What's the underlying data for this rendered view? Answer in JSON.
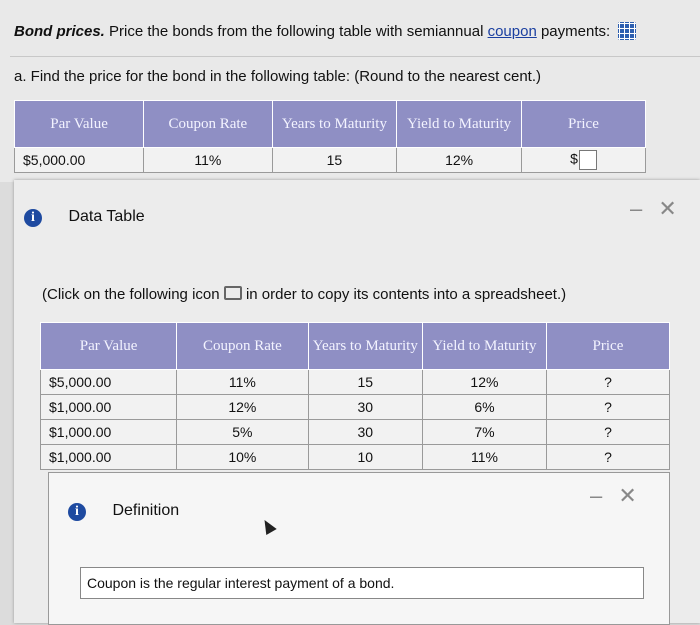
{
  "problem": {
    "title": "Bond prices.",
    "text": "Price the bonds from the following table with semiannual",
    "link": "coupon",
    "text_after": "payments:",
    "grid_icon": "table-grid-icon",
    "part_a": "a. Find the price for the bond in the following table:  (Round to the nearest cent.)"
  },
  "question_table": {
    "headers": [
      "Par Value",
      "Coupon Rate",
      "Years to Maturity",
      "Yield to Maturity",
      "Price"
    ],
    "row": [
      "$5,000.00",
      "11%",
      "15",
      "12%",
      "$"
    ]
  },
  "data_dialog": {
    "title": "Data Table",
    "instruction_before": "(Click on the following icon",
    "instruction_after": "in order to copy its contents into a spreadsheet.)",
    "minimize": "–",
    "close": "✕",
    "headers": [
      "Par Value",
      "Coupon Rate",
      "Years to Maturity",
      "Yield to Maturity",
      "Price"
    ],
    "rows": [
      [
        "$5,000.00",
        "11%",
        "15",
        "12%",
        "?"
      ],
      [
        "$1,000.00",
        "12%",
        "30",
        "6%",
        "?"
      ],
      [
        "$1,000.00",
        "5%",
        "30",
        "7%",
        "?"
      ],
      [
        "$1,000.00",
        "10%",
        "10",
        "11%",
        "?"
      ]
    ]
  },
  "definition_dialog": {
    "title": "Definition",
    "minimize": "–",
    "close": "✕",
    "text": "Coupon is the regular interest payment of a bond."
  },
  "colors": {
    "header_bg": "#8f8fc4",
    "link": "#1a3fa0",
    "info_icon": "#1e4aa0"
  }
}
